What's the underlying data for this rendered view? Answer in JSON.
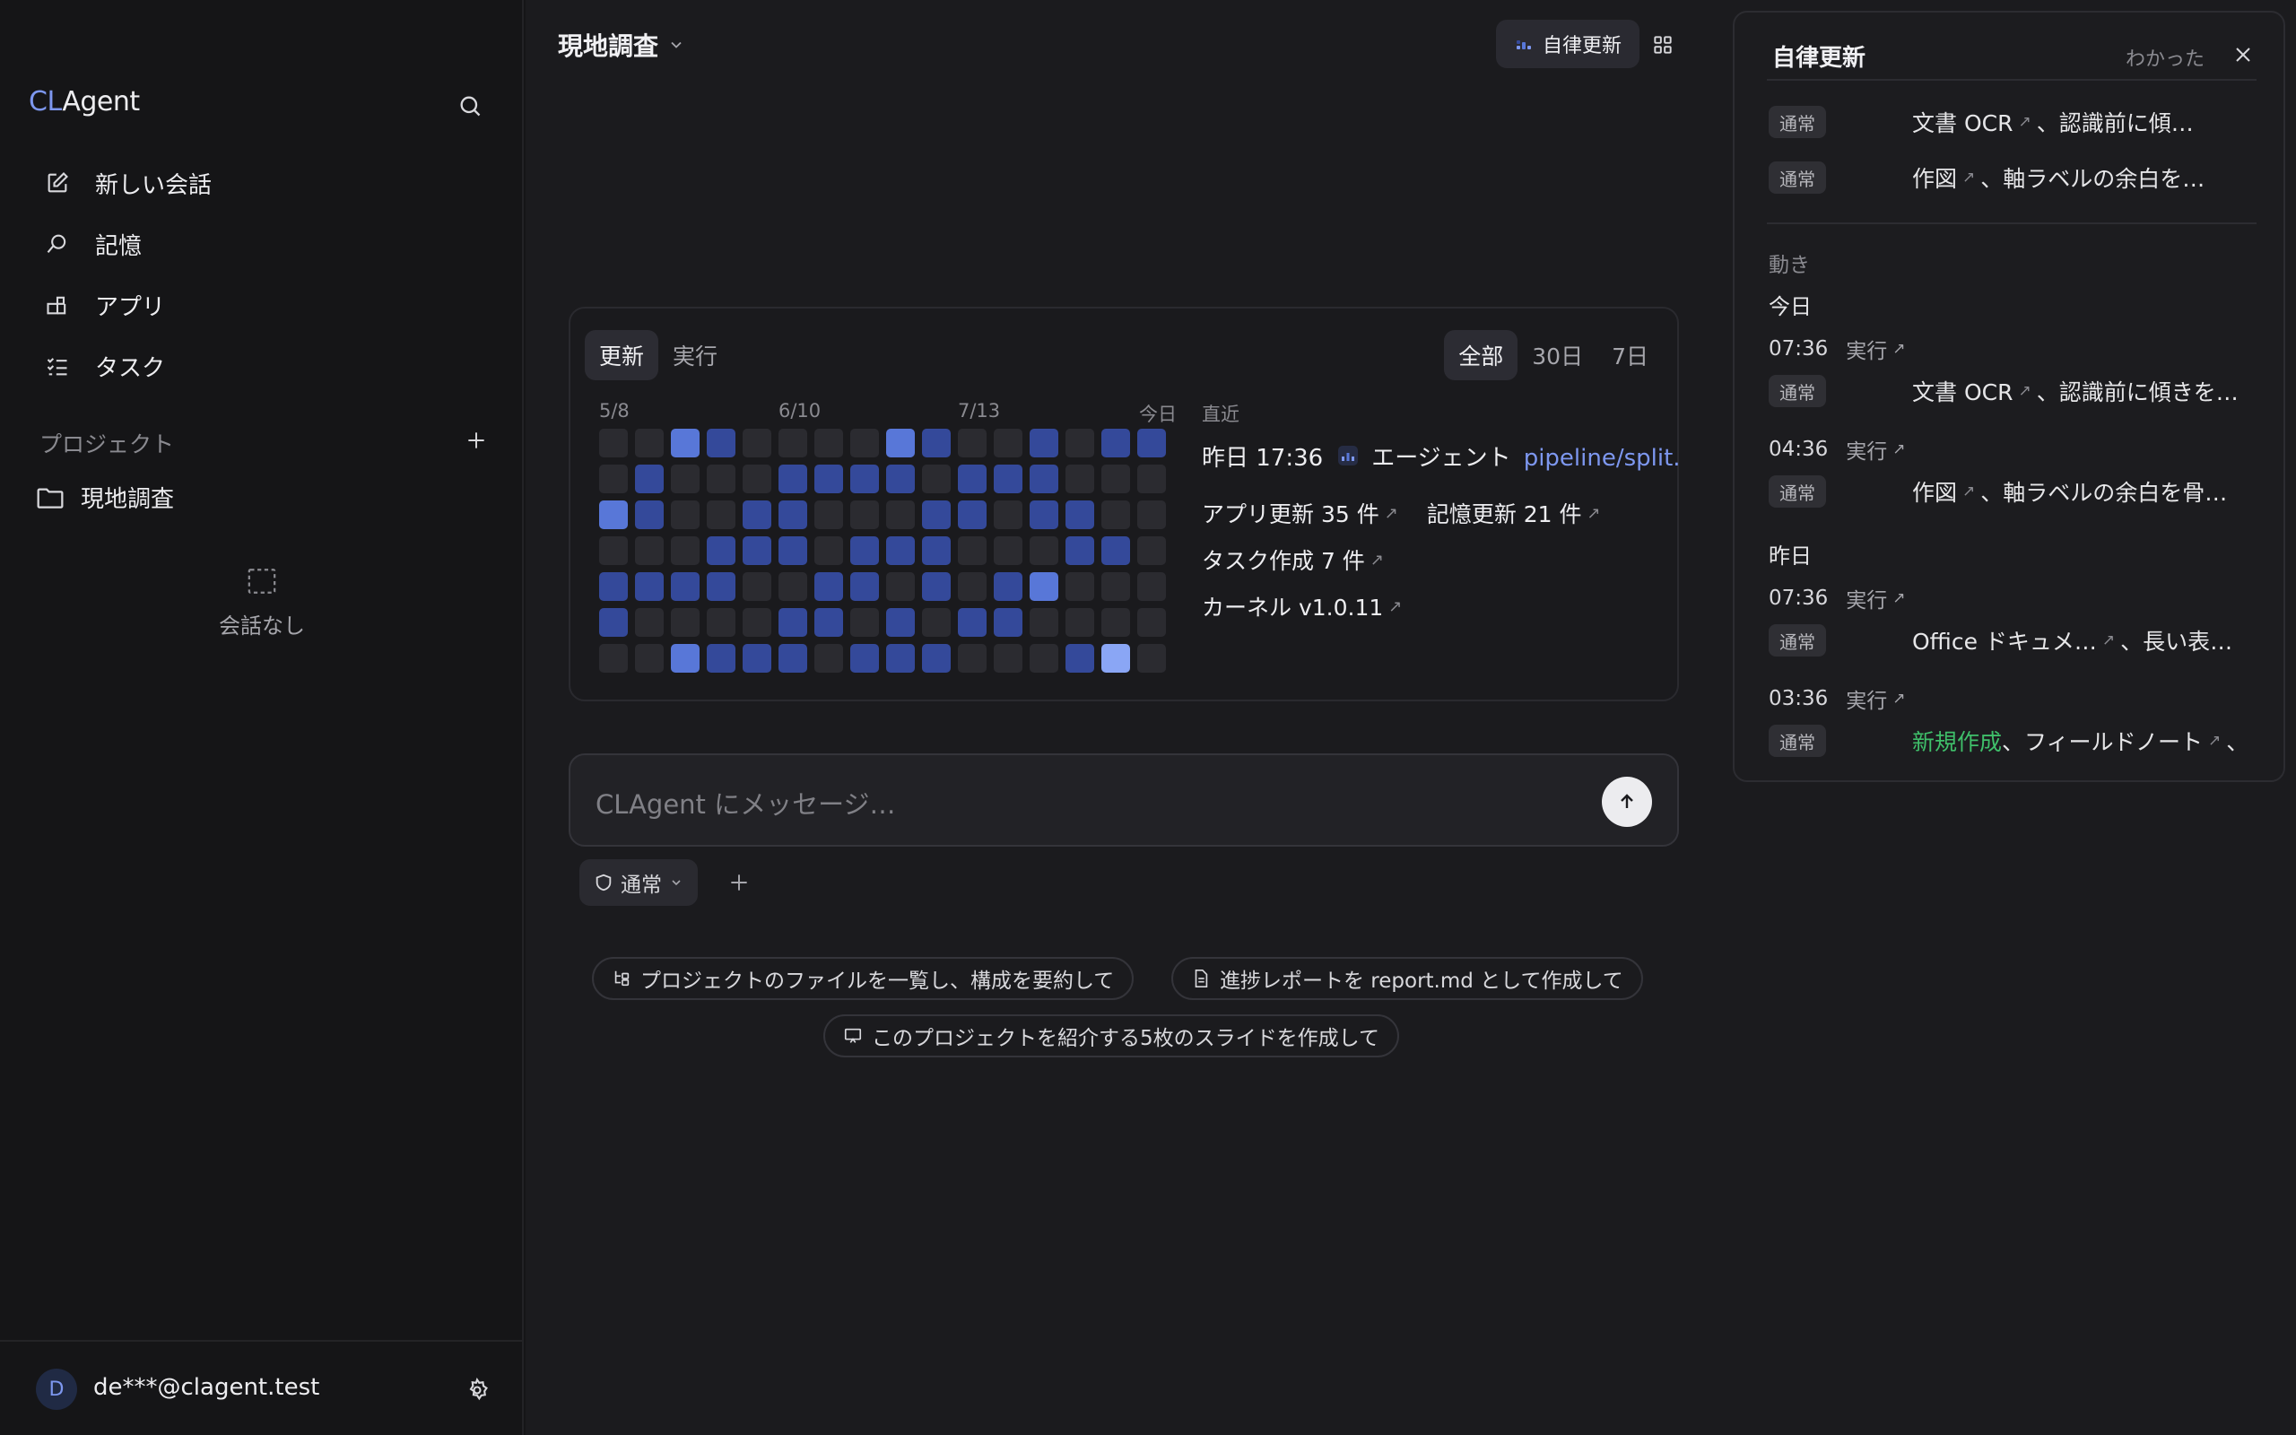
{
  "app": {
    "logo_part1": "CL",
    "logo_part2": "Agent"
  },
  "sidebar": {
    "nav": [
      {
        "label": "新しい会話",
        "icon": "edit-icon"
      },
      {
        "label": "記憶",
        "icon": "memory-icon"
      },
      {
        "label": "アプリ",
        "icon": "apps-icon"
      },
      {
        "label": "タスク",
        "icon": "tasks-icon"
      }
    ],
    "projects_header": "プロジェクト",
    "project": "現地調査",
    "empty_label": "会話なし",
    "user_initial": "D",
    "user_email": "de***@clagent.test"
  },
  "header": {
    "title": "現地調査",
    "auto_update_label": "自律更新"
  },
  "activity_card": {
    "tabs": [
      "更新",
      "実行"
    ],
    "ranges": [
      "全部",
      "30日",
      "7日"
    ],
    "date_labels": [
      "5/8",
      "6/10",
      "7/13",
      "今日"
    ],
    "heatmap_levels": [
      [
        0,
        0,
        3,
        2,
        0,
        0,
        0,
        0,
        3,
        2,
        0,
        0,
        2,
        0,
        2,
        2
      ],
      [
        0,
        2,
        0,
        0,
        0,
        2,
        2,
        2,
        2,
        0,
        2,
        2,
        2,
        0,
        0,
        0
      ],
      [
        3,
        2,
        0,
        0,
        2,
        2,
        0,
        0,
        0,
        2,
        2,
        0,
        2,
        2,
        0,
        0
      ],
      [
        0,
        0,
        0,
        2,
        2,
        2,
        0,
        2,
        2,
        2,
        0,
        0,
        0,
        2,
        2,
        0
      ],
      [
        2,
        2,
        2,
        2,
        0,
        0,
        2,
        2,
        0,
        2,
        0,
        2,
        3,
        0,
        0,
        0
      ],
      [
        2,
        0,
        0,
        0,
        0,
        2,
        2,
        0,
        2,
        0,
        2,
        2,
        0,
        0,
        0,
        0
      ],
      [
        0,
        0,
        3,
        2,
        2,
        2,
        0,
        2,
        2,
        2,
        0,
        0,
        0,
        2,
        4,
        0
      ]
    ],
    "heatmap_colors": [
      "#2b2b30",
      "#28304f",
      "#34499a",
      "#5877d8",
      "#8aa6f5"
    ],
    "recent_header": "直近",
    "recent_time": "昨日 17:36",
    "recent_actor": "エージェント",
    "recent_link": "pipeline/split.py を…",
    "stats": {
      "app_updates": "アプリ更新 35 件",
      "memory_updates": "記憶更新 21 件",
      "tasks_created": "タスク作成 7 件",
      "kernel": "カーネル v1.0.11"
    }
  },
  "composer": {
    "placeholder": "CLAgent にメッセージ…",
    "mode": "通常"
  },
  "suggestions": [
    "プロジェクトのファイルを一覧し、構成を要約して",
    "進捗レポートを report.md として作成して",
    "このプロジェクトを紹介する5枚のスライドを作成して"
  ],
  "panel": {
    "title": "自律更新",
    "ack": "わかった",
    "top_items": [
      {
        "badge": "通常",
        "text": "文書 OCR",
        "rest": "、認識前に傾…"
      },
      {
        "badge": "通常",
        "text": "作図",
        "rest": "、軸ラベルの余白を…"
      }
    ],
    "section_label": "動き",
    "days": [
      {
        "label": "今日",
        "entries": [
          {
            "time": "07:36",
            "kind": "実行",
            "badge": "通常",
            "text": "文書 OCR",
            "rest": "、認識前に傾きを…"
          },
          {
            "time": "04:36",
            "kind": "実行",
            "badge": "通常",
            "text": "作図",
            "rest": "、軸ラベルの余白を骨…"
          }
        ]
      },
      {
        "label": "昨日",
        "entries": [
          {
            "time": "07:36",
            "kind": "実行",
            "badge": "通常",
            "text": "Office ドキュメ…",
            "rest": "、長い表…"
          },
          {
            "time": "03:36",
            "kind": "実行",
            "badge": "通常",
            "green": "新規作成",
            "text": "、フィールドノート",
            "rest": "、"
          }
        ]
      }
    ]
  }
}
